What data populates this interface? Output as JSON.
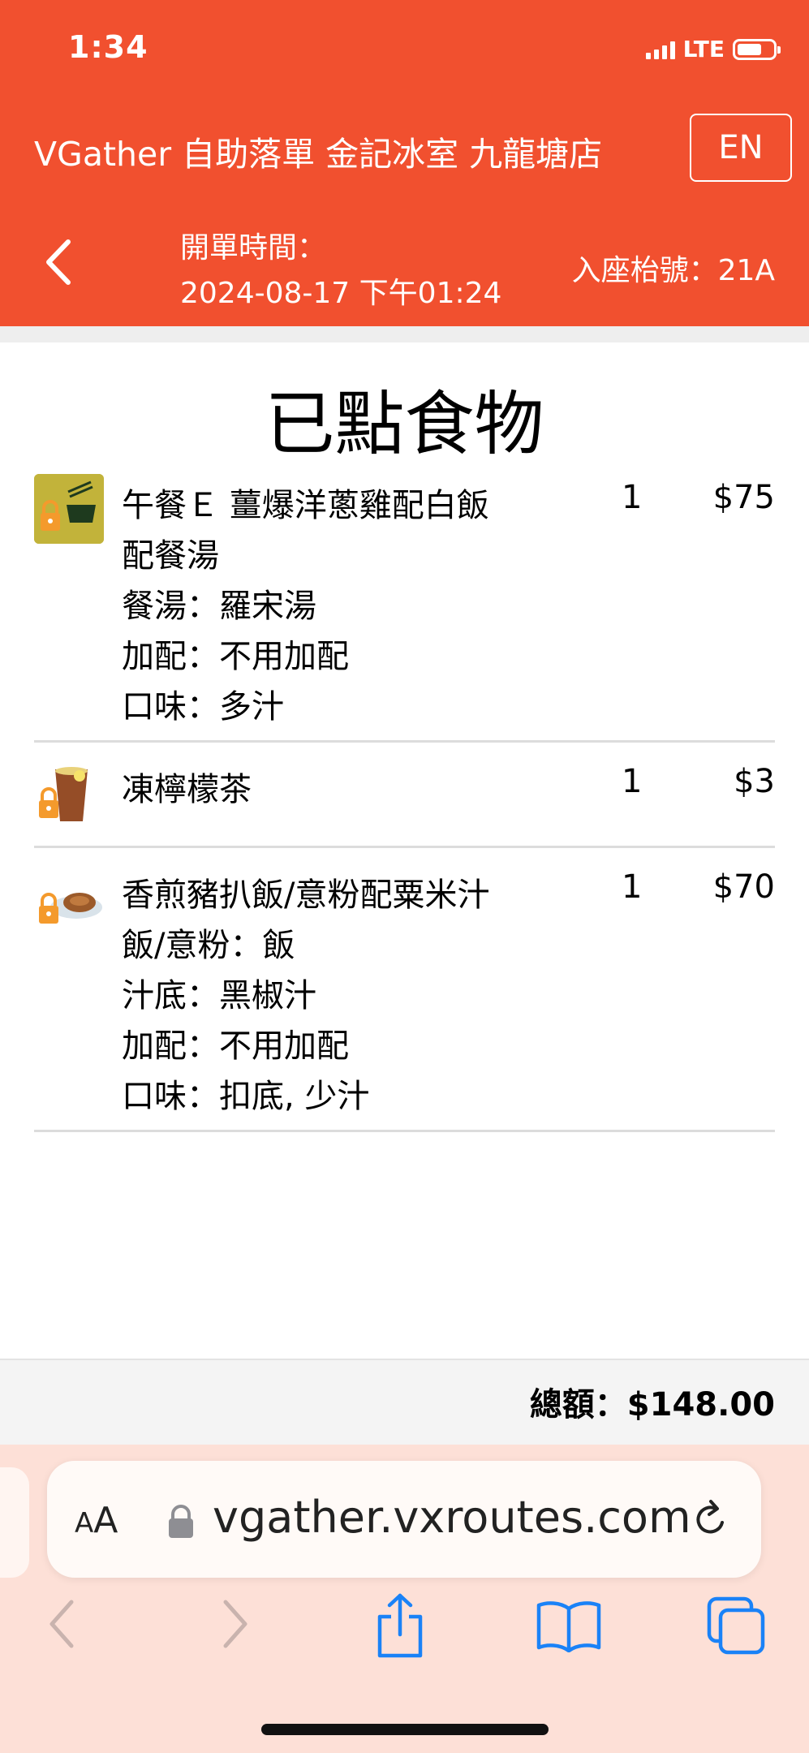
{
  "status_bar": {
    "time": "1:34",
    "network": "LTE"
  },
  "header": {
    "app_title": "VGather 自助落單 金記冰室 九龍塘店",
    "lang_button": "EN",
    "open_time_label": "開單時間：",
    "open_time_value": "2024-08-17 下午01:24",
    "table_number": "入座枱號：21A"
  },
  "page_title": "已點食物",
  "orders": [
    {
      "name": "午餐Ｅ 薑爆洋蔥雞配白飯",
      "name_line2": "配餐湯",
      "options": [
        "餐湯：羅宋湯",
        "加配：不用加配",
        "口味：多汁"
      ],
      "qty": "1",
      "price": "$75"
    },
    {
      "name": "凍檸檬茶",
      "options": [],
      "qty": "1",
      "price": "$3"
    },
    {
      "name": "香煎豬扒飯/意粉配粟米汁",
      "options": [
        "飯/意粉：飯",
        "汁底：黑椒汁",
        "加配：不用加配",
        "口味：扣底, 少汁"
      ],
      "qty": "1",
      "price": "$70"
    }
  ],
  "total": "總額：$148.00",
  "browser": {
    "aa_label_small": "A",
    "aa_label_big": "A",
    "url": "vgather.vxroutes.com"
  },
  "colors": {
    "brand": "#f1502f",
    "safari_tint": "#fde0d7",
    "ios_blue": "#1a82f7"
  },
  "icons": [
    "chevron-left-icon",
    "lock-icon",
    "reload-icon",
    "back-arrow-icon",
    "forward-arrow-icon",
    "share-icon",
    "bookmarks-icon",
    "tabs-icon"
  ]
}
